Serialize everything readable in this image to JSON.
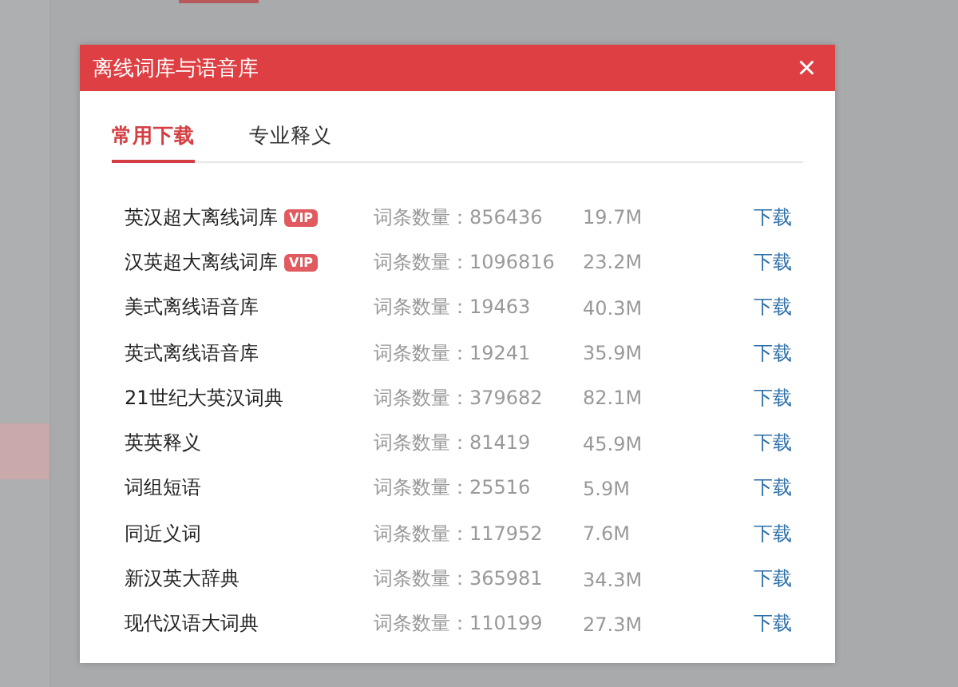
{
  "dialog": {
    "title": "离线词库与语音库",
    "close": "×"
  },
  "tabs": [
    {
      "label": "常用下载",
      "selected": true
    },
    {
      "label": "专业释义",
      "selected": false
    }
  ],
  "rows": [
    {
      "name": "英汉超大离线词库",
      "badge": "VIP",
      "count": "词条数量：856436",
      "size": "19.7M",
      "action": "下载"
    },
    {
      "name": "汉英超大离线词库",
      "badge": "VIP",
      "count": "词条数量：1096816",
      "size": "23.2M",
      "action": "下载"
    },
    {
      "name": "美式离线语音库",
      "count": "词条数量：19463",
      "size": "40.3M",
      "action": "下载"
    },
    {
      "name": "英式离线语音库",
      "count": "词条数量：19241",
      "size": "35.9M",
      "action": "下载"
    },
    {
      "name": "21世纪大英汉词典",
      "count": "词条数量：379682",
      "size": "82.1M",
      "action": "下载"
    },
    {
      "name": "英英释义",
      "count": "词条数量：81419",
      "size": "45.9M",
      "action": "下载"
    },
    {
      "name": "词组短语",
      "count": "词条数量：25516",
      "size": "5.9M",
      "action": "下载"
    },
    {
      "name": "同近义词",
      "count": "词条数量：117952",
      "size": "7.6M",
      "action": "下载"
    },
    {
      "name": "新汉英大辞典",
      "count": "词条数量：365981",
      "size": "34.3M",
      "action": "下载"
    },
    {
      "name": "现代汉语大词典",
      "count": "词条数量：110199",
      "size": "27.3M",
      "action": "下载"
    }
  ]
}
